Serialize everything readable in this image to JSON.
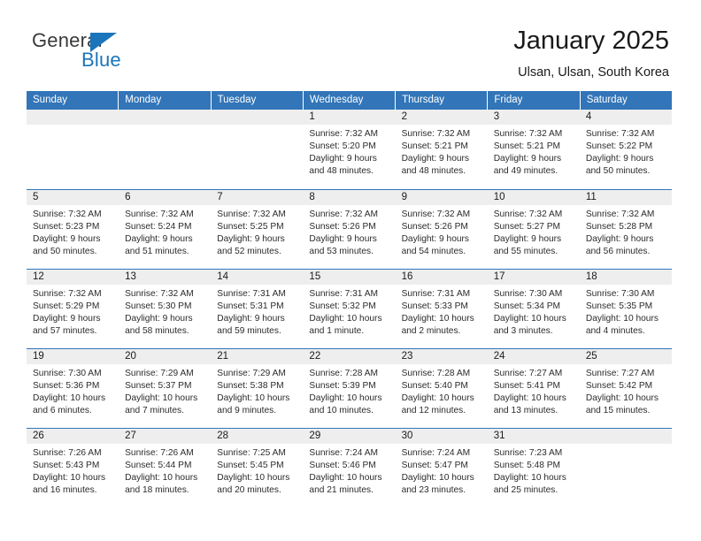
{
  "logo": {
    "word_top": "General",
    "word_bottom": "Blue",
    "accent_color": "#1b75bb",
    "triangle_icon": "triangle-icon"
  },
  "header": {
    "title": "January 2025",
    "subtitle": "Ulsan, Ulsan, South Korea"
  },
  "theme": {
    "header_bar_color": "#3275b8",
    "date_band_color": "#eeeeee",
    "row_divider_color": "#3275b8",
    "text_color": "#2b2b2b"
  },
  "weekday_headers": [
    "Sunday",
    "Monday",
    "Tuesday",
    "Wednesday",
    "Thursday",
    "Friday",
    "Saturday"
  ],
  "weeks": [
    [
      {
        "date": "",
        "empty": true
      },
      {
        "date": "",
        "empty": true
      },
      {
        "date": "",
        "empty": true
      },
      {
        "date": "1",
        "sunrise": "Sunrise: 7:32 AM",
        "sunset": "Sunset: 5:20 PM",
        "daylight_1": "Daylight: 9 hours",
        "daylight_2": "and 48 minutes."
      },
      {
        "date": "2",
        "sunrise": "Sunrise: 7:32 AM",
        "sunset": "Sunset: 5:21 PM",
        "daylight_1": "Daylight: 9 hours",
        "daylight_2": "and 48 minutes."
      },
      {
        "date": "3",
        "sunrise": "Sunrise: 7:32 AM",
        "sunset": "Sunset: 5:21 PM",
        "daylight_1": "Daylight: 9 hours",
        "daylight_2": "and 49 minutes."
      },
      {
        "date": "4",
        "sunrise": "Sunrise: 7:32 AM",
        "sunset": "Sunset: 5:22 PM",
        "daylight_1": "Daylight: 9 hours",
        "daylight_2": "and 50 minutes."
      }
    ],
    [
      {
        "date": "5",
        "sunrise": "Sunrise: 7:32 AM",
        "sunset": "Sunset: 5:23 PM",
        "daylight_1": "Daylight: 9 hours",
        "daylight_2": "and 50 minutes."
      },
      {
        "date": "6",
        "sunrise": "Sunrise: 7:32 AM",
        "sunset": "Sunset: 5:24 PM",
        "daylight_1": "Daylight: 9 hours",
        "daylight_2": "and 51 minutes."
      },
      {
        "date": "7",
        "sunrise": "Sunrise: 7:32 AM",
        "sunset": "Sunset: 5:25 PM",
        "daylight_1": "Daylight: 9 hours",
        "daylight_2": "and 52 minutes."
      },
      {
        "date": "8",
        "sunrise": "Sunrise: 7:32 AM",
        "sunset": "Sunset: 5:26 PM",
        "daylight_1": "Daylight: 9 hours",
        "daylight_2": "and 53 minutes."
      },
      {
        "date": "9",
        "sunrise": "Sunrise: 7:32 AM",
        "sunset": "Sunset: 5:26 PM",
        "daylight_1": "Daylight: 9 hours",
        "daylight_2": "and 54 minutes."
      },
      {
        "date": "10",
        "sunrise": "Sunrise: 7:32 AM",
        "sunset": "Sunset: 5:27 PM",
        "daylight_1": "Daylight: 9 hours",
        "daylight_2": "and 55 minutes."
      },
      {
        "date": "11",
        "sunrise": "Sunrise: 7:32 AM",
        "sunset": "Sunset: 5:28 PM",
        "daylight_1": "Daylight: 9 hours",
        "daylight_2": "and 56 minutes."
      }
    ],
    [
      {
        "date": "12",
        "sunrise": "Sunrise: 7:32 AM",
        "sunset": "Sunset: 5:29 PM",
        "daylight_1": "Daylight: 9 hours",
        "daylight_2": "and 57 minutes."
      },
      {
        "date": "13",
        "sunrise": "Sunrise: 7:32 AM",
        "sunset": "Sunset: 5:30 PM",
        "daylight_1": "Daylight: 9 hours",
        "daylight_2": "and 58 minutes."
      },
      {
        "date": "14",
        "sunrise": "Sunrise: 7:31 AM",
        "sunset": "Sunset: 5:31 PM",
        "daylight_1": "Daylight: 9 hours",
        "daylight_2": "and 59 minutes."
      },
      {
        "date": "15",
        "sunrise": "Sunrise: 7:31 AM",
        "sunset": "Sunset: 5:32 PM",
        "daylight_1": "Daylight: 10 hours",
        "daylight_2": "and 1 minute."
      },
      {
        "date": "16",
        "sunrise": "Sunrise: 7:31 AM",
        "sunset": "Sunset: 5:33 PM",
        "daylight_1": "Daylight: 10 hours",
        "daylight_2": "and 2 minutes."
      },
      {
        "date": "17",
        "sunrise": "Sunrise: 7:30 AM",
        "sunset": "Sunset: 5:34 PM",
        "daylight_1": "Daylight: 10 hours",
        "daylight_2": "and 3 minutes."
      },
      {
        "date": "18",
        "sunrise": "Sunrise: 7:30 AM",
        "sunset": "Sunset: 5:35 PM",
        "daylight_1": "Daylight: 10 hours",
        "daylight_2": "and 4 minutes."
      }
    ],
    [
      {
        "date": "19",
        "sunrise": "Sunrise: 7:30 AM",
        "sunset": "Sunset: 5:36 PM",
        "daylight_1": "Daylight: 10 hours",
        "daylight_2": "and 6 minutes."
      },
      {
        "date": "20",
        "sunrise": "Sunrise: 7:29 AM",
        "sunset": "Sunset: 5:37 PM",
        "daylight_1": "Daylight: 10 hours",
        "daylight_2": "and 7 minutes."
      },
      {
        "date": "21",
        "sunrise": "Sunrise: 7:29 AM",
        "sunset": "Sunset: 5:38 PM",
        "daylight_1": "Daylight: 10 hours",
        "daylight_2": "and 9 minutes."
      },
      {
        "date": "22",
        "sunrise": "Sunrise: 7:28 AM",
        "sunset": "Sunset: 5:39 PM",
        "daylight_1": "Daylight: 10 hours",
        "daylight_2": "and 10 minutes."
      },
      {
        "date": "23",
        "sunrise": "Sunrise: 7:28 AM",
        "sunset": "Sunset: 5:40 PM",
        "daylight_1": "Daylight: 10 hours",
        "daylight_2": "and 12 minutes."
      },
      {
        "date": "24",
        "sunrise": "Sunrise: 7:27 AM",
        "sunset": "Sunset: 5:41 PM",
        "daylight_1": "Daylight: 10 hours",
        "daylight_2": "and 13 minutes."
      },
      {
        "date": "25",
        "sunrise": "Sunrise: 7:27 AM",
        "sunset": "Sunset: 5:42 PM",
        "daylight_1": "Daylight: 10 hours",
        "daylight_2": "and 15 minutes."
      }
    ],
    [
      {
        "date": "26",
        "sunrise": "Sunrise: 7:26 AM",
        "sunset": "Sunset: 5:43 PM",
        "daylight_1": "Daylight: 10 hours",
        "daylight_2": "and 16 minutes."
      },
      {
        "date": "27",
        "sunrise": "Sunrise: 7:26 AM",
        "sunset": "Sunset: 5:44 PM",
        "daylight_1": "Daylight: 10 hours",
        "daylight_2": "and 18 minutes."
      },
      {
        "date": "28",
        "sunrise": "Sunrise: 7:25 AM",
        "sunset": "Sunset: 5:45 PM",
        "daylight_1": "Daylight: 10 hours",
        "daylight_2": "and 20 minutes."
      },
      {
        "date": "29",
        "sunrise": "Sunrise: 7:24 AM",
        "sunset": "Sunset: 5:46 PM",
        "daylight_1": "Daylight: 10 hours",
        "daylight_2": "and 21 minutes."
      },
      {
        "date": "30",
        "sunrise": "Sunrise: 7:24 AM",
        "sunset": "Sunset: 5:47 PM",
        "daylight_1": "Daylight: 10 hours",
        "daylight_2": "and 23 minutes."
      },
      {
        "date": "31",
        "sunrise": "Sunrise: 7:23 AM",
        "sunset": "Sunset: 5:48 PM",
        "daylight_1": "Daylight: 10 hours",
        "daylight_2": "and 25 minutes."
      },
      {
        "date": "",
        "empty": true
      }
    ]
  ]
}
